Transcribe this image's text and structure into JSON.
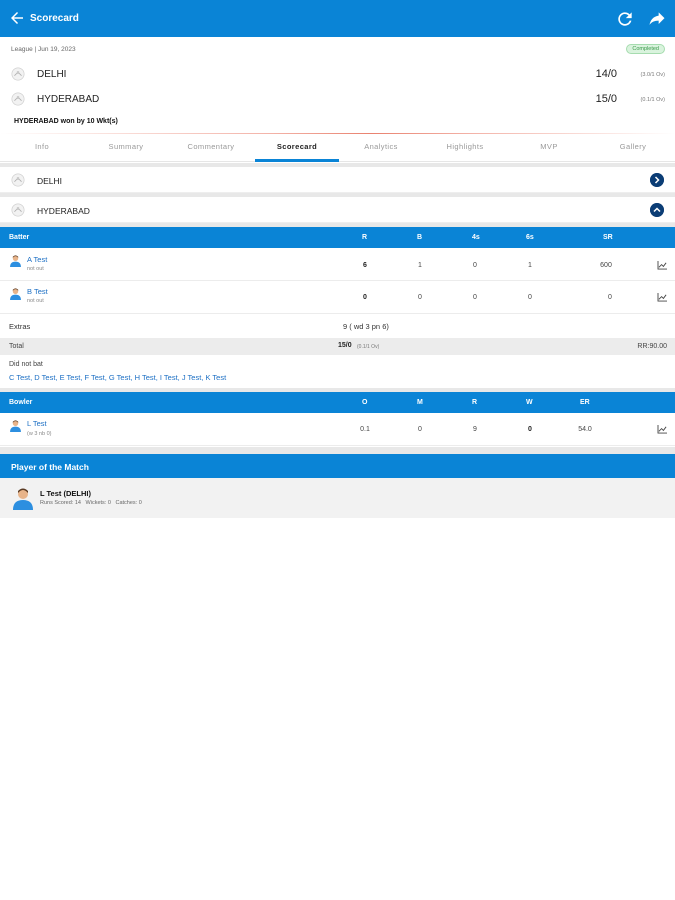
{
  "appbar": {
    "title": "Scorecard"
  },
  "match": {
    "meta": "League | Jun 19, 2023",
    "status": "Completed",
    "teams": [
      {
        "name": "DELHI",
        "score": "14/0",
        "overs": "(3.0/1 Ov)"
      },
      {
        "name": "HYDERABAD",
        "score": "15/0",
        "overs": "(0.1/1 Ov)"
      }
    ],
    "result": "HYDERABAD won by 10 Wkt(s)"
  },
  "tabs": [
    "Info",
    "Summary",
    "Commentary",
    "Scorecard",
    "Analytics",
    "Highlights",
    "MVP",
    "Gallery"
  ],
  "active_tab": "Scorecard",
  "innings": [
    {
      "team": "DELHI",
      "expanded": false
    },
    {
      "team": "HYDERABAD",
      "expanded": true
    }
  ],
  "batting": {
    "headers": [
      "Batter",
      "R",
      "B",
      "4s",
      "6s",
      "SR"
    ],
    "rows": [
      {
        "name": "A Test",
        "status": "not out",
        "r": "6",
        "b": "1",
        "fours": "0",
        "sixes": "1",
        "sr": "600"
      },
      {
        "name": "B Test",
        "status": "not out",
        "r": "0",
        "b": "0",
        "fours": "0",
        "sixes": "0",
        "sr": "0"
      }
    ],
    "extras_label": "Extras",
    "extras_value": "9 ( wd 3 pn 6)",
    "total_label": "Total",
    "total_value": "15/0",
    "total_overs": "(0.1/1 Ov)",
    "run_rate": "RR:90.00",
    "dnb_label": "Did not bat",
    "dnb_list": "C Test, D Test, E Test, F Test, G Test, H Test, I Test, J Test, K Test"
  },
  "bowling": {
    "headers": [
      "Bowler",
      "O",
      "M",
      "R",
      "W",
      "ER"
    ],
    "rows": [
      {
        "name": "L Test",
        "detail": "(w 3 nb 0)",
        "o": "0.1",
        "m": "0",
        "r": "9",
        "w": "0",
        "er": "54.0"
      }
    ]
  },
  "potm": {
    "header": "Player of the Match",
    "name": "L Test (DELHI)",
    "stats": "Runs Scored: 14   Wickets: 0   Catches: 0"
  },
  "colors": {
    "primary": "#0a84d6",
    "dark_chevron": "#0b3d75",
    "link": "#1c6fc4"
  },
  "icons": [
    "back-arrow-icon",
    "refresh-icon",
    "share-icon",
    "team-logo-icon",
    "chevron-right-icon",
    "chevron-up-icon",
    "player-avatar-icon",
    "graph-icon"
  ]
}
